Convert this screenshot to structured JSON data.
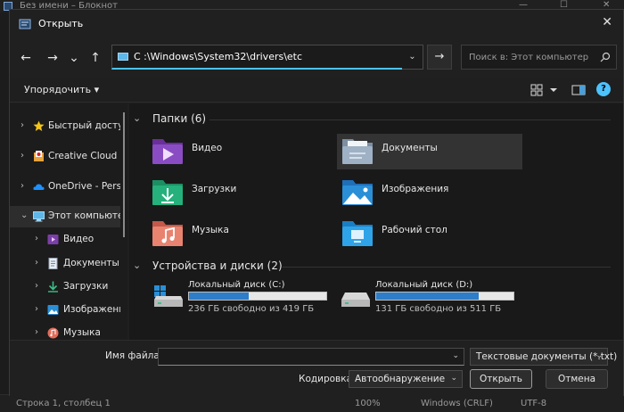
{
  "background_window": {
    "title": "Без имени – Блокнот",
    "status": {
      "position": "Строка 1, столбец 1",
      "zoom": "100%",
      "line_endings": "Windows (CRLF)",
      "encoding": "UTF-8"
    }
  },
  "dialog": {
    "title": "Открыть",
    "close_glyph": "✕"
  },
  "navigation": {
    "back_glyph": "←",
    "forward_glyph": "→",
    "recent_glyph": "⌄",
    "up_glyph": "↑",
    "address": "C :\\Windows\\System32\\drivers\\etc",
    "go_glyph": "→",
    "search_placeholder": "Поиск в: Этот компьютер"
  },
  "command_bar": {
    "organize_label": "Упорядочить ▾",
    "help_glyph": "?"
  },
  "sidebar": {
    "items": [
      {
        "label": "Быстрый доступ",
        "icon": "star-icon",
        "chevron": "›"
      },
      {
        "label": "Creative Cloud F",
        "icon": "creative-cloud-icon",
        "chevron": "›"
      },
      {
        "label": "OneDrive - Perso",
        "icon": "onedrive-icon",
        "chevron": "›"
      },
      {
        "label": "Этот компьютер",
        "icon": "computer-icon",
        "chevron": "⌄",
        "selected": true
      },
      {
        "label": "Видео",
        "icon": "video-folder-icon",
        "chevron": "›"
      },
      {
        "label": "Документы",
        "icon": "documents-folder-icon",
        "chevron": "›"
      },
      {
        "label": "Загрузки",
        "icon": "downloads-folder-icon",
        "chevron": "›"
      },
      {
        "label": "Изображения",
        "icon": "pictures-folder-icon",
        "chevron": "›"
      },
      {
        "label": "Музыка",
        "icon": "music-folder-icon",
        "chevron": "›"
      }
    ]
  },
  "main": {
    "folders_header": "Папки (6)",
    "folders": [
      {
        "label": "Видео",
        "icon": "video-folder-icon"
      },
      {
        "label": "Документы",
        "icon": "documents-folder-icon",
        "selected": true
      },
      {
        "label": "Загрузки",
        "icon": "downloads-folder-icon"
      },
      {
        "label": "Изображения",
        "icon": "pictures-folder-icon"
      },
      {
        "label": "Музыка",
        "icon": "music-folder-icon"
      },
      {
        "label": "Рабочий стол",
        "icon": "desktop-folder-icon"
      }
    ],
    "drives_header": "Устройства и диски (2)",
    "drives": [
      {
        "name": "Локальный диск (C:)",
        "free": "236 ГБ свободно из 419 ГБ",
        "used_fraction": 0.437
      },
      {
        "name": "Локальный диск (D:)",
        "free": "131 ГБ свободно из 511 ГБ",
        "used_fraction": 0.744
      }
    ]
  },
  "bottom": {
    "filename_label": "Имя файла:",
    "filename_value": "",
    "filetype_value": "Текстовые документы (*.txt)",
    "encoding_label": "Кодировка:",
    "encoding_value": "Автообнаружение",
    "open_label": "Открыть",
    "cancel_label": "Отмена"
  },
  "colors": {
    "accent": "#4cc2ff",
    "drive_fill": "#2d7dc8",
    "background": "#1f1f1f"
  }
}
